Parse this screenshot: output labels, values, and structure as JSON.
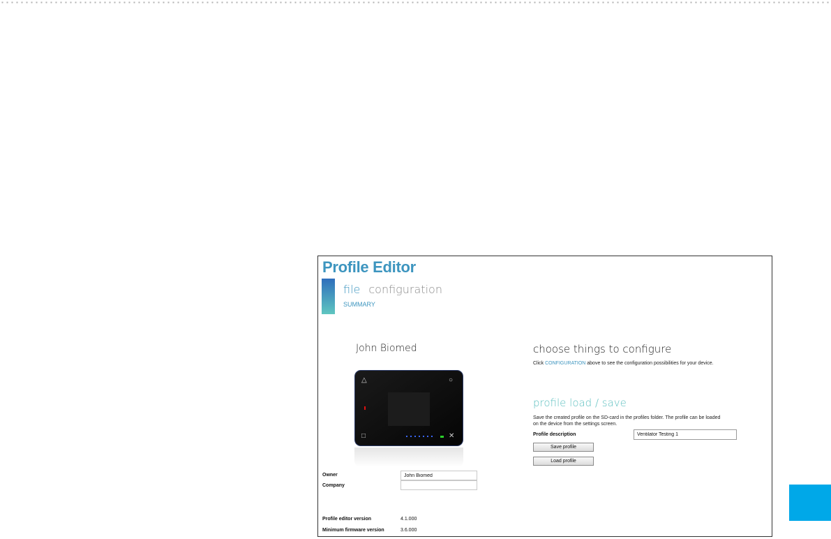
{
  "app": {
    "title": "Profile Editor"
  },
  "nav": {
    "tabs": [
      {
        "label": "file",
        "active": true
      },
      {
        "label": "configuration",
        "active": false
      }
    ],
    "sub": "SUMMARY"
  },
  "owner_display": "John Biomed",
  "device": {
    "buttons": {
      "top_left": "△",
      "top_right": "○",
      "bottom_left": "□",
      "bottom_right": "✕"
    }
  },
  "fields": {
    "owner": {
      "label": "Owner",
      "value": "John Biomed"
    },
    "company": {
      "label": "Company",
      "value": ""
    }
  },
  "versions": {
    "editor": {
      "label": "Profile editor version",
      "value": "4.1.000"
    },
    "firmware": {
      "label": "Minimum firmware version",
      "value": "3.6.000"
    }
  },
  "configure": {
    "heading": "choose things to configure",
    "text_before": "Click ",
    "link": "CONFIGURATION",
    "text_after": " above to see the configuration possibilities for your  device."
  },
  "profile": {
    "heading": "profile load / save",
    "line1": "Save the created profile on the SD-card in the profiles folder. The profile can be loaded",
    "line2": "on the device from the settings screen.",
    "desc_label": "Profile description",
    "desc_value": "Ventilator Testing 1",
    "save_label": "Save profile",
    "load_label": "Load profile"
  },
  "colors": {
    "accent": "#3d95bf",
    "teal": "#5ec0c0",
    "side_tab": "#00a8e8"
  }
}
